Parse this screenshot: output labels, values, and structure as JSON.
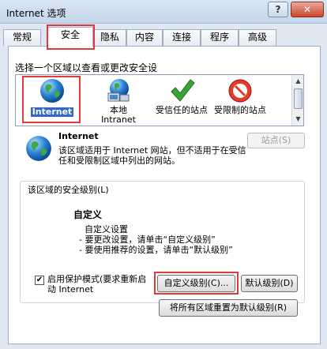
{
  "window": {
    "title": "Internet 选项",
    "help_label": "?",
    "close_label": "✕"
  },
  "tabs": [
    "常规",
    "安全",
    "隐私",
    "内容",
    "连接",
    "程序",
    "高级"
  ],
  "zones_section": {
    "heading": "选择一个区域以查看或更改安全设",
    "zones": [
      {
        "name": "Internet",
        "icon": "globe-icon",
        "selected": true
      },
      {
        "name": "本地\nIntranet",
        "icon": "intranet-globe-icon",
        "selected": false
      },
      {
        "name": "受信任的站点",
        "icon": "green-check-icon",
        "selected": false
      },
      {
        "name": "受限制的站点",
        "icon": "red-restricted-icon",
        "selected": false
      }
    ]
  },
  "selected_zone": {
    "name": "Internet",
    "description": "该区域适用于 Internet 网站，但不适用于在受信任和受限制区域中列出的网站。",
    "sites_button": "站点(S)"
  },
  "security_level": {
    "group_title": "该区域的安全级别(L)",
    "level_name": "自定义",
    "lines": [
      "自定义设置",
      "- 要更改设置，请单击“自定义级别”",
      "- 要使用推荐的设置，请单击“默认级别”"
    ],
    "protected_mode_label": "启用保护模式(要求重新启动 Internet",
    "protected_mode_checked": true,
    "custom_level_button": "自定义级别(C)...",
    "default_level_button": "默认级别(D)",
    "reset_all_button": "将所有区域重置为默认级别(R)"
  },
  "colors": {
    "highlight": "#e03a3a",
    "selection": "#3168c9"
  }
}
